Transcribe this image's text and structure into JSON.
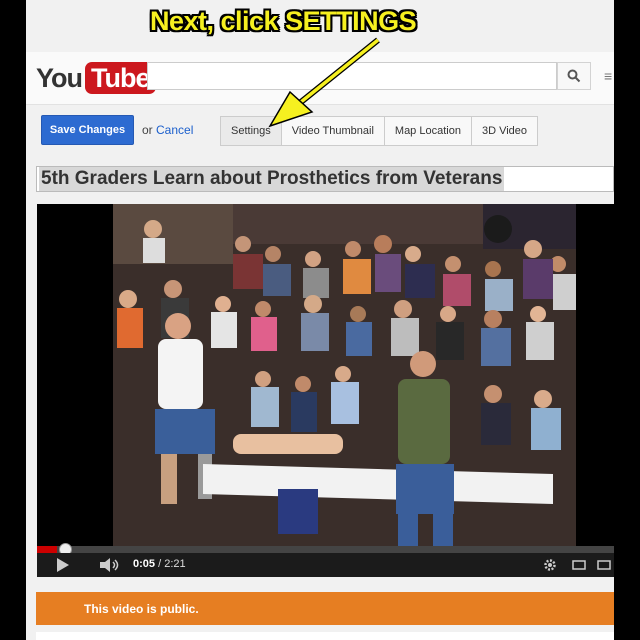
{
  "annotation": {
    "text": "Next, click SETTINGS"
  },
  "header": {
    "logo_you": "You",
    "logo_tube": "Tube",
    "search_value": "",
    "search_icon": "search-icon"
  },
  "toolbar": {
    "save_label": "Save Changes",
    "or_text": "or",
    "cancel_label": "Cancel",
    "tabs": [
      {
        "label": "Settings"
      },
      {
        "label": "Video Thumbnail"
      },
      {
        "label": "Map Location"
      },
      {
        "label": "3D Video"
      }
    ]
  },
  "video": {
    "title": "5th Graders Learn about Prosthetics from Veterans",
    "time_current": "0:05",
    "time_total": "/ 2:21",
    "progress": 0.035
  },
  "banner": {
    "text": "This video is public."
  },
  "colors": {
    "brand": "#cc181e",
    "primary_button": "#2d6bd1",
    "banner": "#e67e22",
    "annotation": "#f6f020"
  }
}
